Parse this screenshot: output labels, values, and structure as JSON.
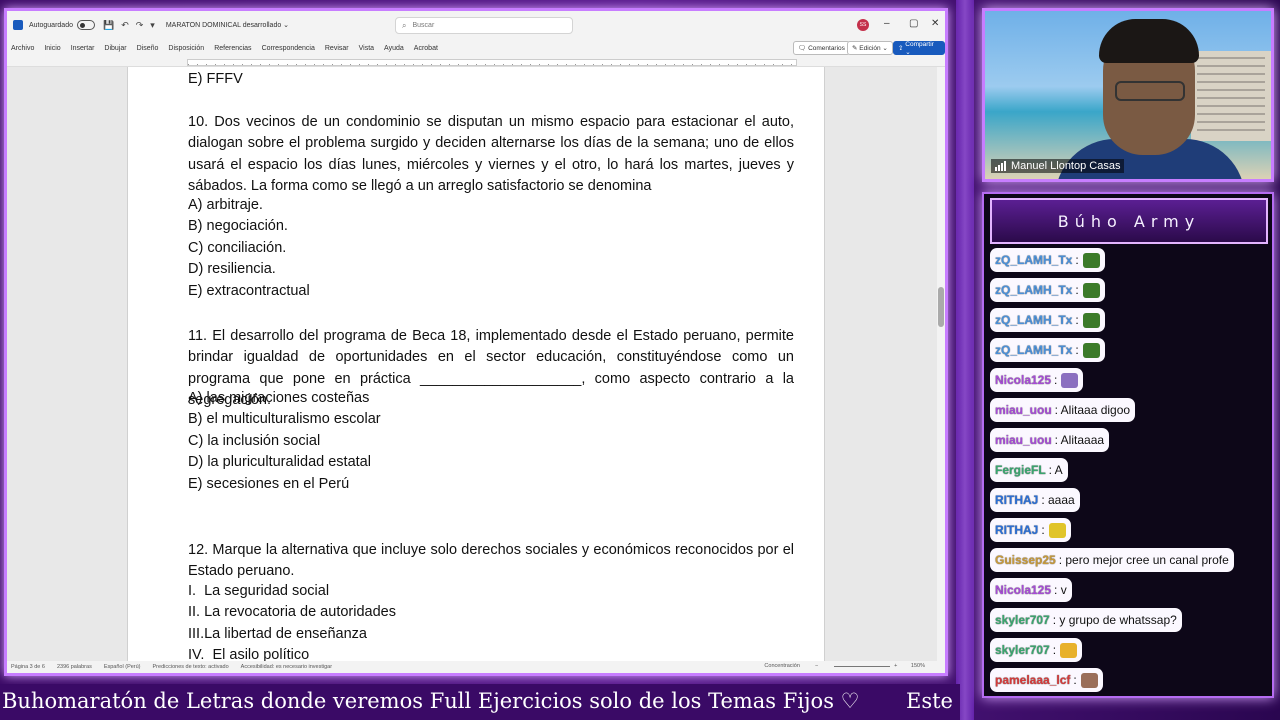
{
  "word": {
    "titlebar": {
      "autosave_label": "Autoguardado",
      "doc_title": "MARATON DOMINICAL desarrollado ⌄",
      "search_placeholder": "Buscar",
      "avatar_initials": "SS"
    },
    "menu": [
      "Archivo",
      "Inicio",
      "Insertar",
      "Dibujar",
      "Diseño",
      "Disposición",
      "Referencias",
      "Correspondencia",
      "Revisar",
      "Vista",
      "Ayuda",
      "Acrobat"
    ],
    "right_buttons": {
      "comments": "Comentarios",
      "edit": "Edición ⌄",
      "share": "Compartir ⌄"
    },
    "document": {
      "top_line": "E) FFFV",
      "q10": {
        "stem": "10. Dos vecinos de un condominio se disputan un mismo espacio para estacionar el auto, dialogan sobre el problema surgido y deciden alternarse los días de la semana; uno de ellos usará el espacio los días lunes, miércoles y viernes y el otro, lo hará los martes, jueves y sábados. La forma como se llegó a un arreglo satisfactorio se denomina",
        "options": [
          "A) arbitraje.",
          "B) negociación.",
          "C) conciliación.",
          "D) resiliencia.",
          "E) extracontractual"
        ]
      },
      "q11": {
        "stem": "11. El desarrollo del programa de Beca 18, implementado desde el Estado peruano, permite brindar igualdad de oportunidades en el sector educación, constituyéndose como un programa que pone en práctica ____________________, como aspecto contrario a la segregación.",
        "options": [
          "A) las migraciones costeñas",
          "B) el multiculturalismo escolar",
          "C) la inclusión social",
          "D) la pluriculturalidad estatal",
          "E) secesiones en el Perú"
        ]
      },
      "q12": {
        "stem": "12. Marque la alternativa que incluye solo derechos sociales y económicos reconocidos por el Estado peruano.",
        "options": [
          "I.  La seguridad social",
          "II. La revocatoria de autoridades",
          "III.La libertad de enseñanza",
          "IV.  El asilo político"
        ]
      }
    },
    "status": {
      "page": "Página 3 de 6",
      "words": "2396 palabras",
      "lang": "Español (Perú)",
      "predict": "Predicciones de texto: activado",
      "access": "Accesibilidad: es necesario investigar",
      "focus": "Concentración",
      "zoom": "150%"
    }
  },
  "webcam": {
    "name": "Manuel Llontop Casas"
  },
  "chat": {
    "title": "Búho Army",
    "messages": [
      {
        "user": "zQ_LAMH_Tx",
        "text": ":",
        "user_color": "#4a90d9",
        "emote_color": "#3c7a2a"
      },
      {
        "user": "zQ_LAMH_Tx",
        "text": ":",
        "user_color": "#4a90d9",
        "emote_color": "#3c7a2a"
      },
      {
        "user": "zQ_LAMH_Tx",
        "text": ":",
        "user_color": "#4a90d9",
        "emote_color": "#3c7a2a"
      },
      {
        "user": "zQ_LAMH_Tx",
        "text": ":",
        "user_color": "#4a90d9",
        "emote_color": "#3c7a2a"
      },
      {
        "user": "Nicola125",
        "text": ":",
        "user_color": "#a64bd6",
        "emote_color": "#8b6fc0"
      },
      {
        "user": "miau_uou",
        "text": ": Alitaaa digoo",
        "user_color": "#a64bd6",
        "emote_color": ""
      },
      {
        "user": "miau_uou",
        "text": ": Alitaaaa",
        "user_color": "#a64bd6",
        "emote_color": ""
      },
      {
        "user": "FergieFL",
        "text": ": A",
        "user_color": "#3aa66f",
        "emote_color": ""
      },
      {
        "user": "RITHAJ",
        "text": ": aaaa",
        "user_color": "#2b6fd6",
        "emote_color": ""
      },
      {
        "user": "RITHAJ",
        "text": ":",
        "user_color": "#2b6fd6",
        "emote_color": "#e0c42a"
      },
      {
        "user": "Guissep25",
        "text": ": pero mejor cree un canal profe",
        "user_color": "#c79a3a",
        "emote_color": ""
      },
      {
        "user": "Nicola125",
        "text": ": v",
        "user_color": "#a64bd6",
        "emote_color": ""
      },
      {
        "user": "skyler707",
        "text": ": y grupo de whatssap?",
        "user_color": "#3aa66f",
        "emote_color": ""
      },
      {
        "user": "skyler707",
        "text": ":",
        "user_color": "#3aa66f",
        "emote_color": "#e8b12c"
      },
      {
        "user": "pamelaaa_lcf",
        "text": ":",
        "user_color": "#d63a3a",
        "emote_color": "#9a6e5a"
      }
    ]
  },
  "ticker": {
    "text": "Buhomaratón de Letras donde veremos Full Ejercicios solo de los Temas Fijos ♡",
    "text2": "Este"
  }
}
